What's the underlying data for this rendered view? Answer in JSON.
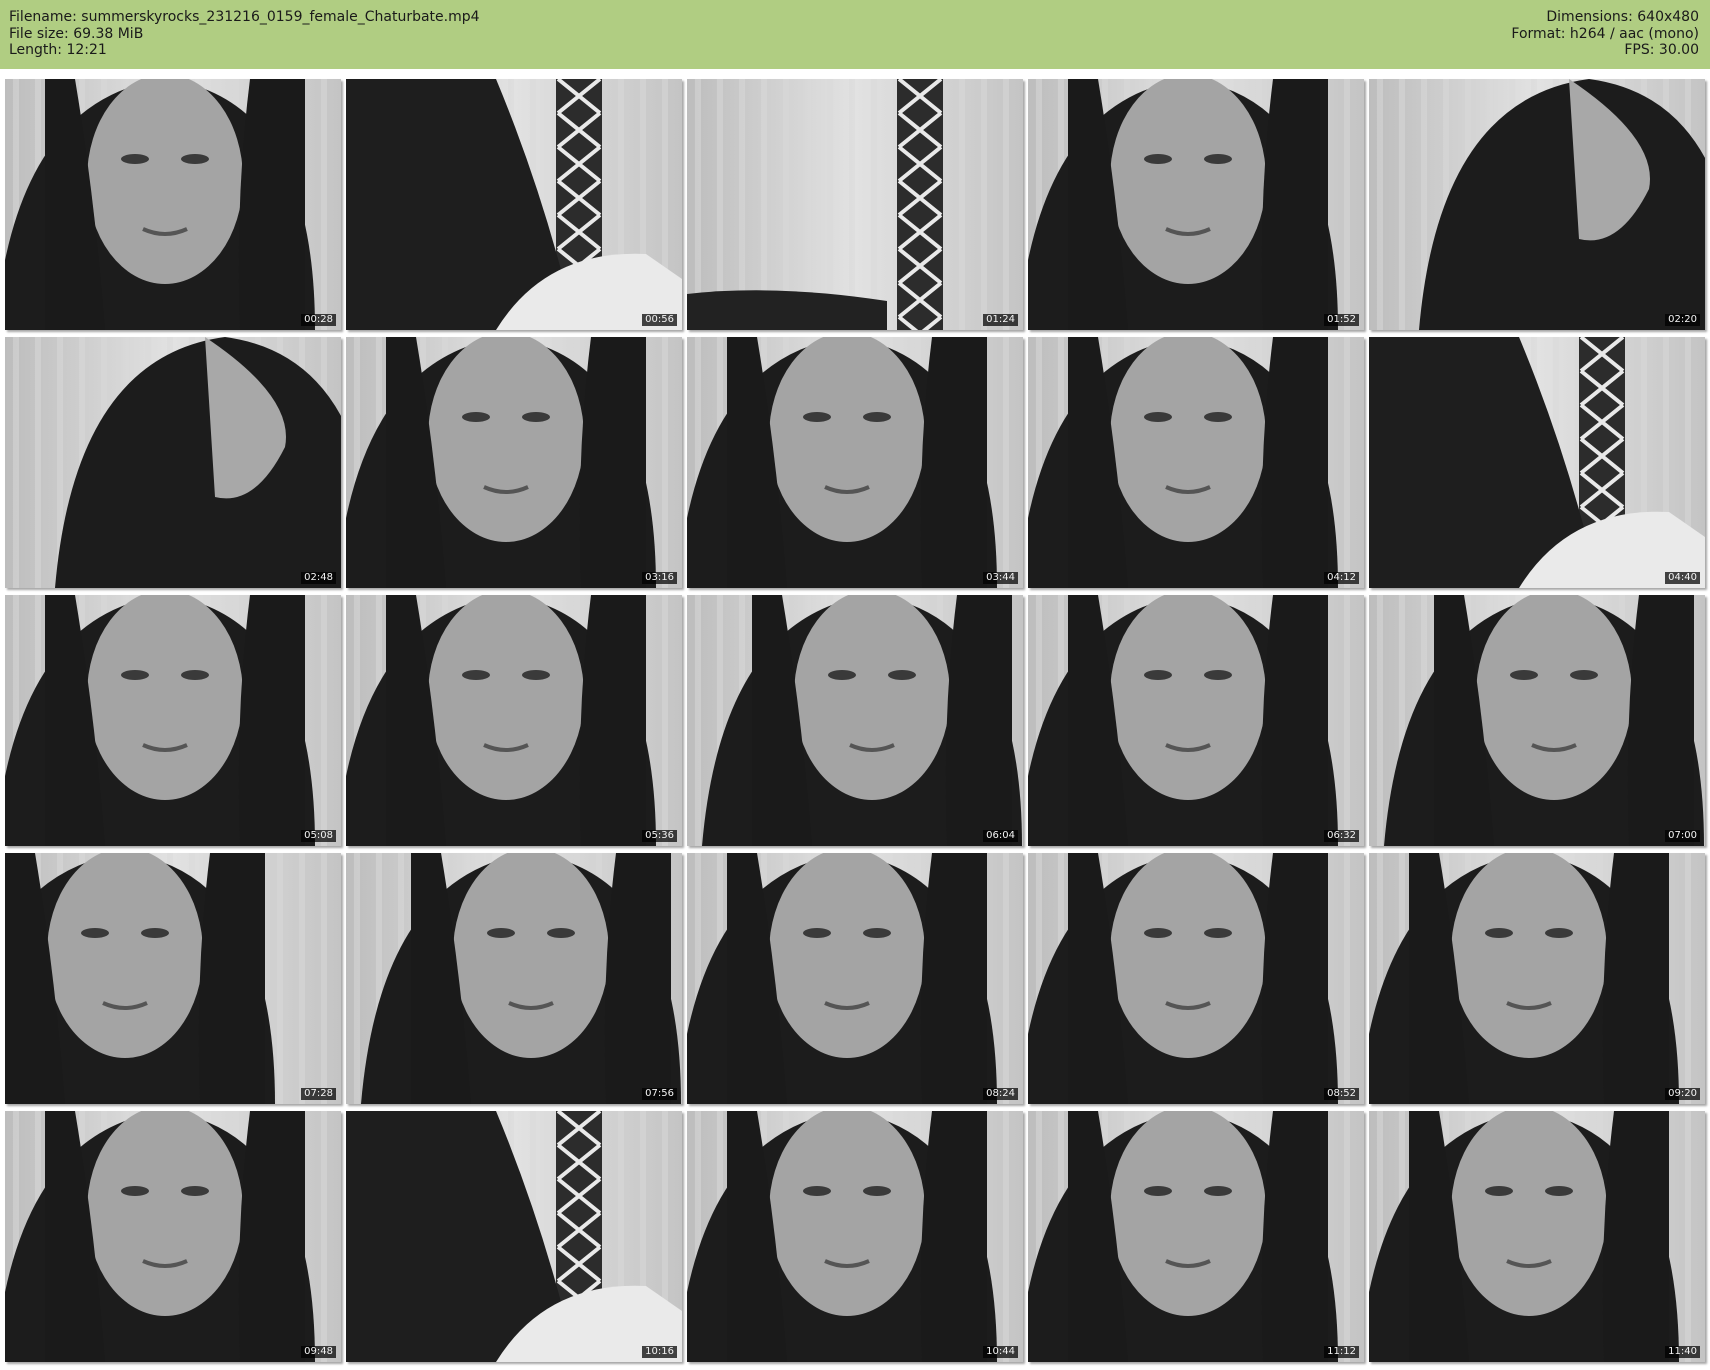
{
  "header": {
    "background": "#b0cd82",
    "left": [
      "Filename: summerskyrocks_231216_0159_female_Chaturbate.mp4",
      "File size: 69.38 MiB",
      "Length: 12:21"
    ],
    "right": [
      "Dimensions: 640x480",
      "Format: h264 / aac (mono)",
      "FPS: 30.00"
    ]
  },
  "thumbnails": [
    {
      "time": "00:28",
      "scene": "face"
    },
    {
      "time": "00:56",
      "scene": "window"
    },
    {
      "time": "01:24",
      "scene": "empty"
    },
    {
      "time": "01:52",
      "scene": "face"
    },
    {
      "time": "02:20",
      "scene": "profile"
    },
    {
      "time": "02:48",
      "scene": "profile"
    },
    {
      "time": "03:16",
      "scene": "face"
    },
    {
      "time": "03:44",
      "scene": "face"
    },
    {
      "time": "04:12",
      "scene": "face"
    },
    {
      "time": "04:40",
      "scene": "window"
    },
    {
      "time": "05:08",
      "scene": "face"
    },
    {
      "time": "05:36",
      "scene": "face"
    },
    {
      "time": "06:04",
      "scene": "face-right"
    },
    {
      "time": "06:32",
      "scene": "face"
    },
    {
      "time": "07:00",
      "scene": "face-right"
    },
    {
      "time": "07:28",
      "scene": "face-left"
    },
    {
      "time": "07:56",
      "scene": "face-right"
    },
    {
      "time": "08:24",
      "scene": "face"
    },
    {
      "time": "08:52",
      "scene": "face"
    },
    {
      "time": "09:20",
      "scene": "face"
    },
    {
      "time": "09:48",
      "scene": "face"
    },
    {
      "time": "10:16",
      "scene": "window"
    },
    {
      "time": "10:44",
      "scene": "face"
    },
    {
      "time": "11:12",
      "scene": "face"
    },
    {
      "time": "11:40",
      "scene": "face"
    }
  ]
}
